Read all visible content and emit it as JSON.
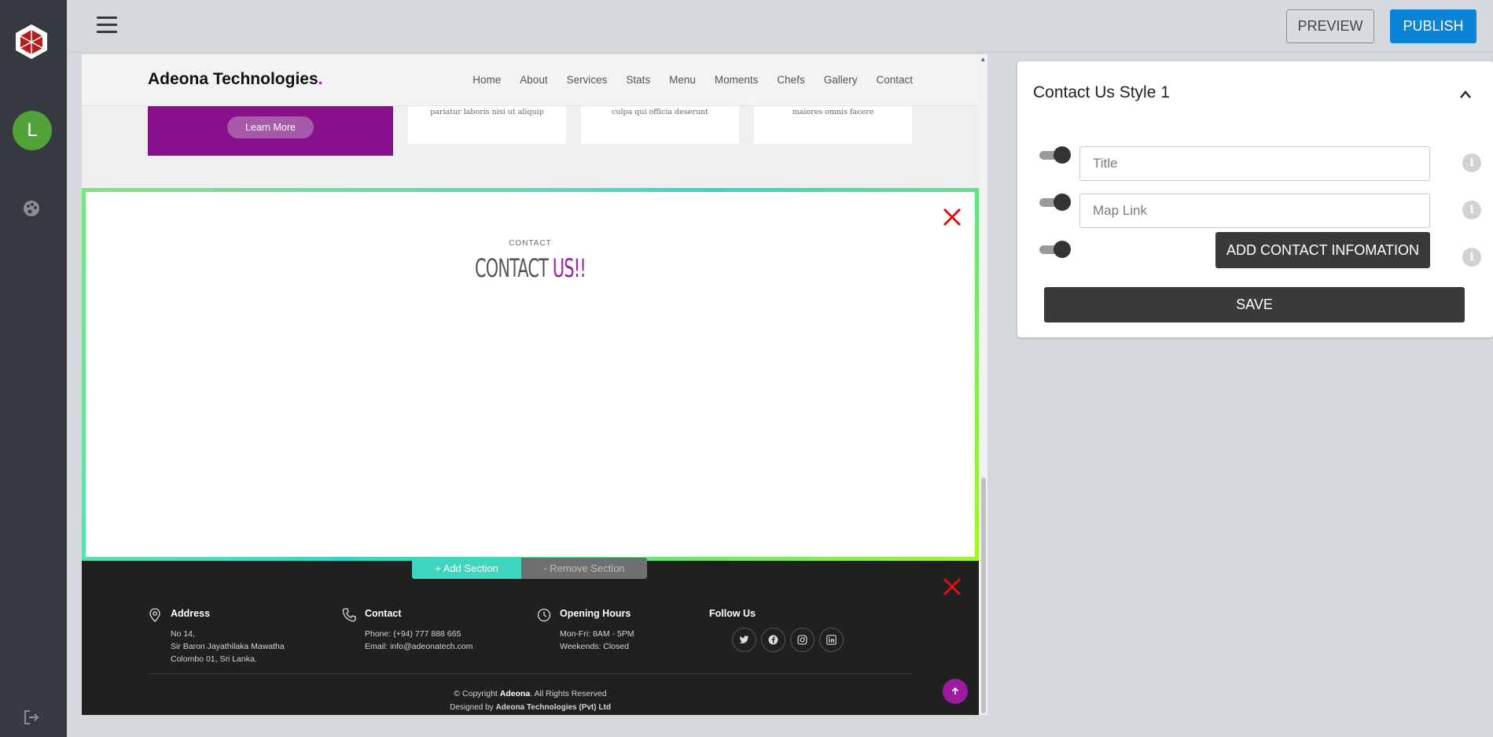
{
  "app": {
    "avatar_initial": "L"
  },
  "topbar": {
    "preview_label": "PREVIEW",
    "publish_label": "PUBLISH"
  },
  "site": {
    "brand": "Adeona Technologies",
    "brand_dot": ".",
    "nav": [
      "Home",
      "About",
      "Services",
      "Stats",
      "Menu",
      "Moments",
      "Chefs",
      "Gallery",
      "Contact"
    ],
    "promo_button": "Learn More",
    "cards": [
      "pariatur laboris nisi ut aliquip",
      "culpa qui officia deserunt",
      "maiores omnis facere"
    ]
  },
  "contact_section": {
    "eyebrow": "CONTACT",
    "title_main": "CONTACT ",
    "title_accent": "US!!"
  },
  "section_controls": {
    "add": "+ Add Section",
    "remove": "- Remove Section"
  },
  "footer": {
    "address": {
      "heading": "Address",
      "lines": [
        "No 14,",
        "Sir Baron Jayathilaka Mawatha",
        "Colombo 01, Sri Lanka."
      ]
    },
    "contact": {
      "heading": "Contact",
      "lines": [
        "Phone: (+94) 777 888 665",
        "Email: info@adeonatech.com"
      ]
    },
    "hours": {
      "heading": "Opening Hours",
      "lines": [
        "Mon-Fri: 8AM - 5PM",
        "Weekends: Closed"
      ]
    },
    "follow": {
      "heading": "Follow Us",
      "icons": [
        "twitter-icon",
        "facebook-icon",
        "instagram-icon",
        "linkedin-icon"
      ]
    },
    "copyright_prefix": "© Copyright ",
    "copyright_brand": "Adeona",
    "copyright_suffix": ". All Rights Reserved",
    "designed_prefix": "Designed by ",
    "designed_brand": "Adeona Technologies (Pvt) Ltd"
  },
  "panel": {
    "title": "Contact Us Style 1",
    "title_placeholder": "Title",
    "maplink_placeholder": "Map Link",
    "add_contact_label": "ADD CONTACT INFOMATION",
    "save_label": "SAVE",
    "info_glyph": "i"
  },
  "colors": {
    "accent": "#9c1ba1",
    "publish": "#0b84d8",
    "avatar": "#52a23a",
    "close": "#e01010"
  }
}
